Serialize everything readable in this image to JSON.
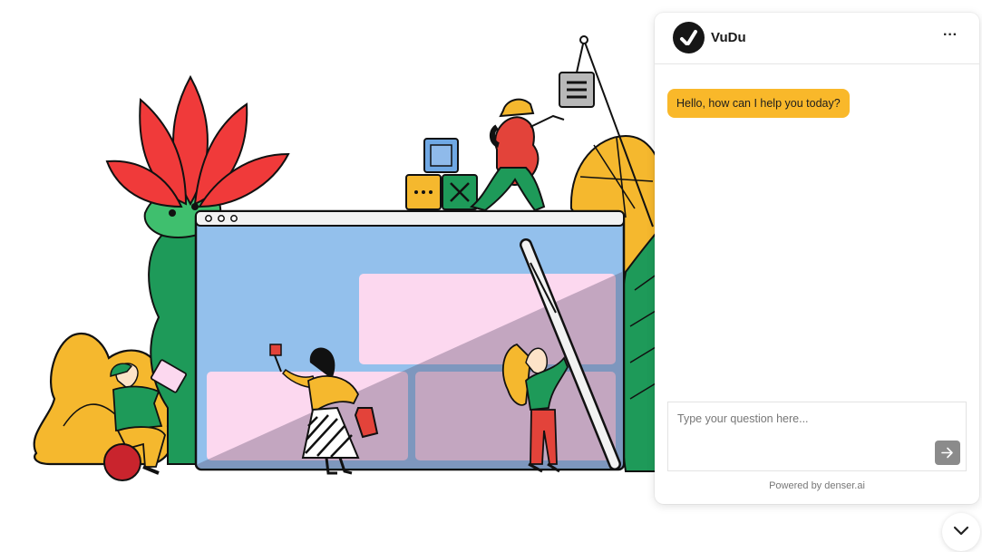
{
  "chat": {
    "brand_name": "VuDu",
    "more_label": "···",
    "greeting": "Hello, how can I help you today?",
    "input_placeholder": "Type your question here...",
    "footer": "Powered by denser.ai",
    "accent_color": "#f9b82a"
  },
  "icons": {
    "logo": "vudu-logo-icon",
    "more": "more-options-icon",
    "send": "arrow-right-icon",
    "collapse": "chevron-down-icon"
  }
}
